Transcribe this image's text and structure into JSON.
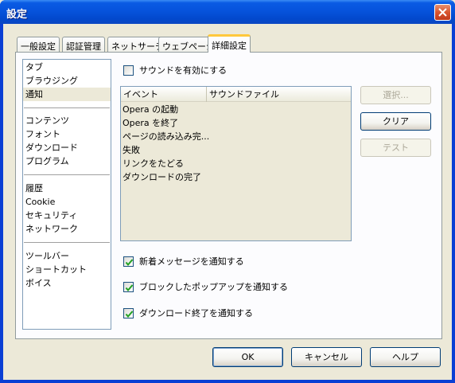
{
  "window": {
    "title": "設定"
  },
  "tabs": [
    {
      "label": "一般設定"
    },
    {
      "label": "認証管理"
    },
    {
      "label": "ネットサーチ"
    },
    {
      "label": "ウェブページ"
    },
    {
      "label": "詳細設定"
    }
  ],
  "categories": {
    "group1": [
      "タブ",
      "ブラウジング",
      "通知"
    ],
    "group2": [
      "コンテンツ",
      "フォント",
      "ダウンロード",
      "プログラム"
    ],
    "group3": [
      "履歴",
      "Cookie",
      "セキュリティ",
      "ネットワーク"
    ],
    "group4": [
      "ツールバー",
      "ショートカット",
      "ボイス"
    ],
    "selected": "通知"
  },
  "sound": {
    "enable_label": "サウンドを有効にする",
    "checked": false
  },
  "event_list": {
    "columns": [
      "イベント",
      "サウンドファイル"
    ],
    "rows": [
      "Opera の起動",
      "Opera を終了",
      "ページの読み込み完...",
      "失敗",
      "リンクをたどる",
      "ダウンロードの完了"
    ]
  },
  "side_buttons": {
    "select": "選択...",
    "clear": "クリア",
    "test": "テスト"
  },
  "notifications": {
    "new_message": {
      "label": "新着メッセージを通知する",
      "checked": true
    },
    "blocked_popup": {
      "label": "ブロックしたポップアップを通知する",
      "checked": true
    },
    "download_done": {
      "label": "ダウンロード終了を通知する",
      "checked": true
    }
  },
  "footer": {
    "ok": "OK",
    "cancel": "キャンセル",
    "help": "ヘルプ"
  }
}
